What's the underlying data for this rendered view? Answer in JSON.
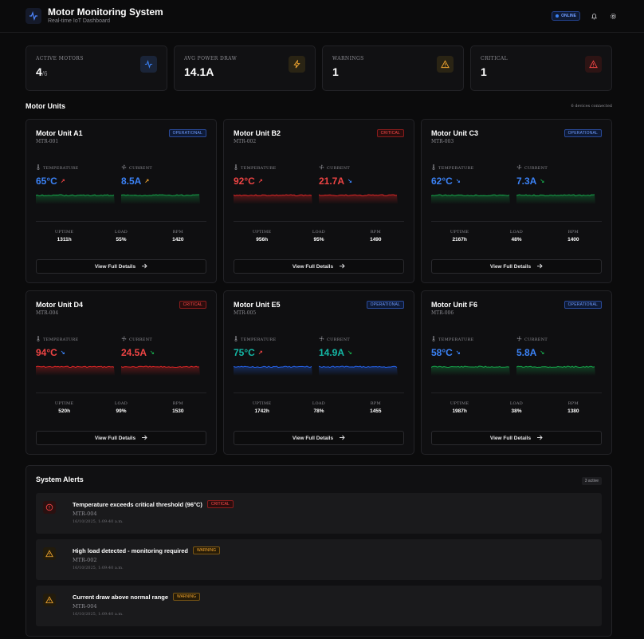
{
  "header": {
    "title": "Motor Monitoring System",
    "subtitle": "Real-time IoT Dashboard",
    "status": "ONLINE"
  },
  "stats": [
    {
      "label": "ACTIVE MOTORS",
      "value": "4",
      "suffix": "/6",
      "icon": "activity-icon",
      "color": "#3b82f6"
    },
    {
      "label": "AVG POWER DRAW",
      "value": "14.1A",
      "suffix": "",
      "icon": "lightning-icon",
      "color": "#f0a530"
    },
    {
      "label": "WARNINGS",
      "value": "1",
      "suffix": "",
      "icon": "warning-triangle-icon",
      "color": "#f0a530"
    },
    {
      "label": "CRITICAL",
      "value": "1",
      "suffix": "",
      "icon": "alert-triangle-icon",
      "color": "#ef4444"
    }
  ],
  "motors_section": {
    "title": "Motor Units",
    "meta": "6 devices connected"
  },
  "labels": {
    "temperature": "TEMPERATURE",
    "current": "CURRENT",
    "uptime": "UPTIME",
    "load": "LOAD",
    "rpm": "RPM",
    "details": "View Full Details"
  },
  "motors": [
    {
      "name": "Motor Unit A1",
      "id": "MTR-001",
      "status": "OPERATIONAL",
      "temp": "65°C",
      "current": "8.5A",
      "temp_color": "#3b82f6",
      "current_color": "#3b82f6",
      "temp_trend": "↗",
      "current_trend": "↗",
      "temp_trend_color": "#ef4444",
      "current_trend_color": "#f0a530",
      "temp_spark_color": "#16a34a",
      "current_spark_color": "#16a34a",
      "uptime": "1311h",
      "load": "55%",
      "rpm": "1420"
    },
    {
      "name": "Motor Unit B2",
      "id": "MTR-002",
      "status": "CRITICAL",
      "temp": "92°C",
      "current": "21.7A",
      "temp_color": "#ef4444",
      "current_color": "#ef4444",
      "temp_trend": "↗",
      "current_trend": "↘",
      "temp_trend_color": "#ef4444",
      "current_trend_color": "#3b82f6",
      "temp_spark_color": "#dc2626",
      "current_spark_color": "#dc2626",
      "uptime": "956h",
      "load": "95%",
      "rpm": "1490"
    },
    {
      "name": "Motor Unit C3",
      "id": "MTR-003",
      "status": "OPERATIONAL",
      "temp": "62°C",
      "current": "7.3A",
      "temp_color": "#3b82f6",
      "current_color": "#3b82f6",
      "temp_trend": "↘",
      "current_trend": "↘",
      "temp_trend_color": "#3b82f6",
      "current_trend_color": "#16a34a",
      "temp_spark_color": "#16a34a",
      "current_spark_color": "#16a34a",
      "uptime": "2167h",
      "load": "48%",
      "rpm": "1400"
    },
    {
      "name": "Motor Unit D4",
      "id": "MTR-004",
      "status": "CRITICAL",
      "temp": "94°C",
      "current": "24.5A",
      "temp_color": "#ef4444",
      "current_color": "#ef4444",
      "temp_trend": "↘",
      "current_trend": "↘",
      "temp_trend_color": "#3b82f6",
      "current_trend_color": "#16a34a",
      "temp_spark_color": "#dc2626",
      "current_spark_color": "#dc2626",
      "uptime": "520h",
      "load": "99%",
      "rpm": "1530"
    },
    {
      "name": "Motor Unit E5",
      "id": "MTR-005",
      "status": "OPERATIONAL",
      "temp": "75°C",
      "current": "14.9A",
      "temp_color": "#14b8a6",
      "current_color": "#14b8a6",
      "temp_trend": "↗",
      "current_trend": "↘",
      "temp_trend_color": "#ef4444",
      "current_trend_color": "#16a34a",
      "temp_spark_color": "#2563eb",
      "current_spark_color": "#2563eb",
      "uptime": "1742h",
      "load": "78%",
      "rpm": "1455"
    },
    {
      "name": "Motor Unit F6",
      "id": "MTR-006",
      "status": "OPERATIONAL",
      "temp": "58°C",
      "current": "5.8A",
      "temp_color": "#3b82f6",
      "current_color": "#3b82f6",
      "temp_trend": "↘",
      "current_trend": "↘",
      "temp_trend_color": "#3b82f6",
      "current_trend_color": "#16a34a",
      "temp_spark_color": "#16a34a",
      "current_spark_color": "#16a34a",
      "uptime": "1987h",
      "load": "38%",
      "rpm": "1380"
    }
  ],
  "alerts": {
    "title": "System Alerts",
    "count": "3 active",
    "items": [
      {
        "message": "Temperature exceeds critical threshold (96°C)",
        "level": "CRITICAL",
        "device": "MTR-004",
        "time": "16/10/2025, 1:09:40 a.m.",
        "color": "#ef4444"
      },
      {
        "message": "High load detected - monitoring required",
        "level": "WARNING",
        "device": "MTR-002",
        "time": "16/10/2025, 1:09:40 a.m.",
        "color": "#f0a530"
      },
      {
        "message": "Current draw above normal range",
        "level": "WARNING",
        "device": "MTR-004",
        "time": "16/10/2025, 1:09:40 a.m.",
        "color": "#f0a530"
      }
    ]
  }
}
